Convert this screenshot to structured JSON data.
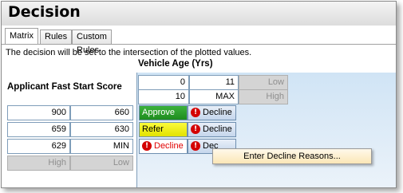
{
  "title": "Decision",
  "tabs": [
    {
      "label": "Matrix"
    },
    {
      "label": "Rules"
    },
    {
      "label": "Custom Rules"
    }
  ],
  "description": "The decision will be set to the intersection of the plotted values.",
  "vehicle_age": {
    "header": "Vehicle Age (Yrs)",
    "rows": [
      {
        "from": "0",
        "to": "11",
        "label": "Low"
      },
      {
        "from": "10",
        "to": "MAX",
        "label": "High"
      }
    ]
  },
  "score": {
    "header": "Applicant Fast Start Score",
    "rows": [
      {
        "from": "900",
        "to": "660"
      },
      {
        "from": "659",
        "to": "630"
      },
      {
        "from": "629",
        "to": "MIN"
      }
    ],
    "footer": {
      "high": "High",
      "low": "Low"
    }
  },
  "matrix": [
    {
      "col1": "Approve",
      "col2": "Decline"
    },
    {
      "col1": "Refer",
      "col2": "Decline"
    },
    {
      "col1": "Decline",
      "col2": "Dec"
    }
  ],
  "context_menu": {
    "item": "Enter Decline Reasons..."
  },
  "colors": {
    "approve": "#1e8c1e",
    "refer": "#f0f000",
    "decline_text": "#e00000",
    "panel": "#d0e4f5"
  }
}
